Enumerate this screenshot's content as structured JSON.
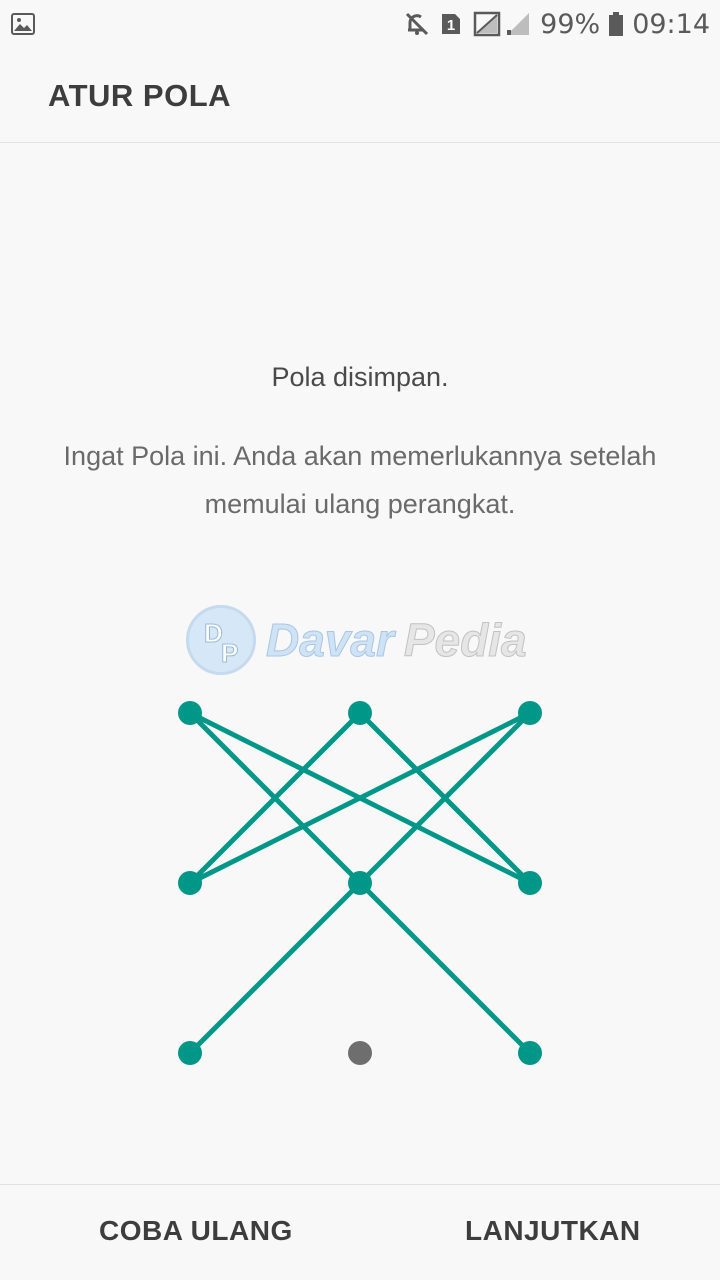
{
  "status_bar": {
    "sim_badge": "1",
    "battery_percent": "99%",
    "time": "09:14",
    "icons": [
      "gallery-icon",
      "mute-icon",
      "sim-badge-icon",
      "signal-icon",
      "battery-icon"
    ]
  },
  "header": {
    "title": "ATUR POLA"
  },
  "message": {
    "title": "Pola disimpan.",
    "body": "Ingat Pola ini. Anda akan memerlukannya setelah memulai ulang perangkat."
  },
  "watermark": {
    "logo_letter_1": "D",
    "logo_letter_2": "P",
    "text_1": "Davar",
    "text_2": "Pedia"
  },
  "pattern": {
    "grid": "3x3",
    "path_order": [
      1,
      5,
      3,
      4,
      2,
      6,
      7
    ],
    "end_dots": [
      9
    ],
    "unselected_dots": [
      8
    ],
    "active_color": "#009688",
    "inactive_color": "#6e6e6e"
  },
  "actions": {
    "retry_label": "COBA ULANG",
    "next_label": "LANJUTKAN"
  }
}
